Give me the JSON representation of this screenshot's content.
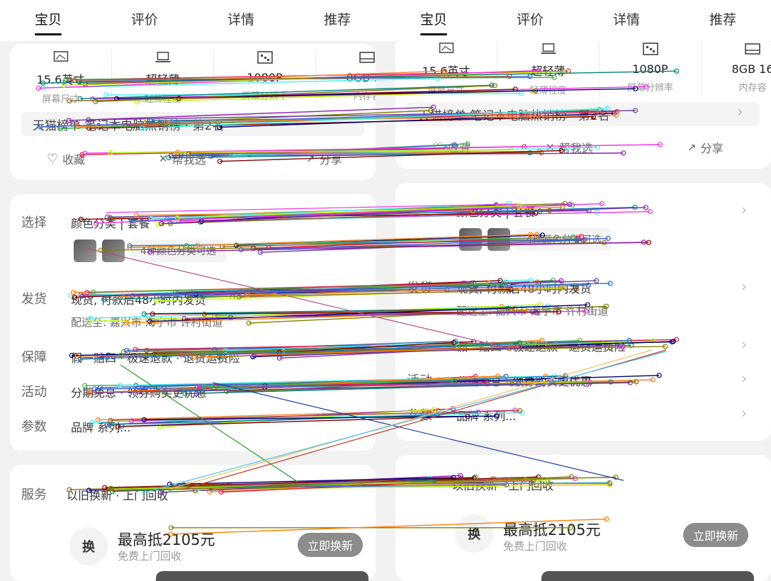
{
  "tabs": [
    "宝贝",
    "评价",
    "详情",
    "推荐"
  ],
  "left": {
    "specs": [
      {
        "icon": "screen-icon",
        "value": "15.6英寸",
        "label": "屏幕尺寸"
      },
      {
        "icon": "laptop-icon",
        "value": "超轻薄",
        "label": "轻薄程度"
      },
      {
        "icon": "resolution-icon",
        "value": "1080P",
        "label": "屏幕分辨率"
      },
      {
        "icon": "memory-icon",
        "value": "8GB 16",
        "label": "内存容"
      }
    ],
    "rank_text": "天猫榜单 笔记本电脑热销榜 · 第2名",
    "actions": {
      "fav": "收藏",
      "gift": "帮我选",
      "share": "分享"
    },
    "rows": {
      "select_label": "选择",
      "select_value": "颜色分类 | 套餐",
      "color_text": "4种颜色分类可选",
      "ship_label": "发货",
      "ship_value": "现货, 付款后48小时内发货",
      "ship_to": "配送至: 嘉兴市 海宁市 许村街道",
      "guarantee_label": "保障",
      "guarantee_value": "假一赔四 · 极速退款 · 退货运费险",
      "promo_label": "活动",
      "promo_value": "分期免息 · 领券购买更优惠",
      "params_label": "参数",
      "params_value": "品牌 系列...",
      "service_label": "服务",
      "service_value": "以旧换新 · 上门回收"
    },
    "tradein": {
      "icon_text": "换",
      "title": "最高抵2105元",
      "sub": "免费上门回收",
      "button": "立即换新"
    }
  },
  "right": {
    "specs": [
      {
        "icon": "screen-icon",
        "value": "15.6英寸",
        "label": "屏幕尺寸"
      },
      {
        "icon": "laptop-icon",
        "value": "超轻薄",
        "label": "轻薄程度"
      },
      {
        "icon": "resolution-icon",
        "value": "1080P",
        "label": "屏幕分辨率"
      },
      {
        "icon": "memory-icon",
        "value": "8GB 16",
        "label": "内存容"
      }
    ],
    "rank_text": "天猫榜单 笔记本电脑热销榜 · 第2名",
    "actions": {
      "fav": "收藏",
      "gift": "帮我选",
      "share": "分享"
    },
    "rows": {
      "select_value": "颜色分类 | 套餐",
      "color_text": "4种颜色分类可选",
      "ship_label": "发货",
      "ship_value": "现货, 付款后48小时内发货",
      "ship_to": "配送至: 嘉兴市 海宁市 许村街道",
      "guarantee_value": "假一赔四 · 极速退款 · 退货运费险",
      "promo_label": "活动",
      "promo_value": "分期免息 · 领券购买更优惠",
      "params_label": "参数",
      "params_value": "品牌 系列...",
      "service_value": "以旧换新 · 上门回收"
    },
    "tradein": {
      "icon_text": "换",
      "title": "最高抵2105元",
      "sub": "免费上门回收",
      "button": "立即换新"
    }
  },
  "colors": {
    "panel_bg": "#f2f2f2",
    "card_bg": "#ffffff",
    "button_gray": "#8c8c8c",
    "line_palette": [
      "#e6194b",
      "#3cb44b",
      "#4363d8",
      "#f58231",
      "#911eb4",
      "#46f0f0",
      "#f032e6",
      "#bcf60c",
      "#008080",
      "#9a6324",
      "#800000",
      "#000075",
      "#808000",
      "#ff7f00",
      "#6a3d9a",
      "#1f78b4"
    ]
  }
}
